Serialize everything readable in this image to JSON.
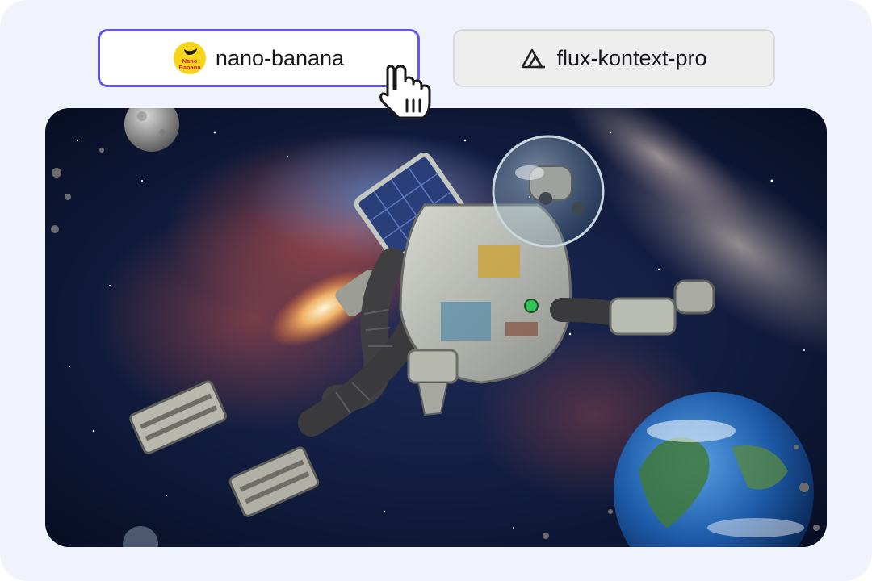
{
  "models": [
    {
      "label": "nano-banana",
      "selected": true,
      "icon": "nano-banana-logo-icon",
      "logo_text": "Nano Banana"
    },
    {
      "label": "flux-kontext-pro",
      "selected": false,
      "icon": "flux-logo-icon"
    }
  ],
  "colors": {
    "page_background": "#f0f3fb",
    "selected_border": "#6556f0",
    "unselected_background": "#eeeeef",
    "banana_yellow": "#f7d51a"
  },
  "image": {
    "subject": "rusty robot astronaut with jetpack floating in space near Earth and the Moon"
  }
}
